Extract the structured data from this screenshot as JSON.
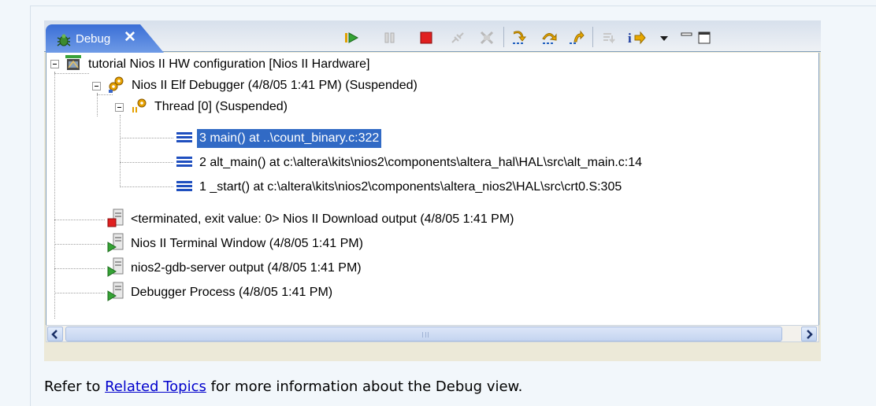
{
  "view": {
    "tab_label": "Debug",
    "tab_close": "✕",
    "toolbar": [
      {
        "name": "resume-icon"
      },
      {
        "name": "suspend-icon"
      },
      {
        "name": "terminate-icon"
      },
      {
        "name": "disconnect-icon"
      },
      {
        "name": "remove-terminated-icon"
      },
      {
        "name": "step-into-icon"
      },
      {
        "name": "step-over-icon"
      },
      {
        "name": "step-return-icon"
      },
      {
        "name": "drop-to-frame-icon"
      },
      {
        "name": "instruction-step-icon"
      },
      {
        "name": "view-menu-icon"
      },
      {
        "name": "minimize-icon"
      },
      {
        "name": "maximize-icon"
      }
    ]
  },
  "tree": {
    "launch": "tutorial Nios II HW configuration [Nios II Hardware]",
    "debugger": "Nios II Elf Debugger (4/8/05 1:41 PM) (Suspended)",
    "thread": "Thread [0] (Suspended)",
    "frames": [
      "3 main() at ..\\count_binary.c:322",
      "2 alt_main() at c:\\altera\\kits\\nios2\\components\\altera_hal\\HAL\\src\\alt_main.c:14",
      "1 _start() at c:\\altera\\kits\\nios2\\components\\altera_nios2\\HAL\\src\\crt0.S:305"
    ],
    "processes": [
      "<terminated, exit value: 0> Nios II Download output (4/8/05 1:41 PM)",
      "Nios II Terminal Window (4/8/05 1:41 PM)",
      "nios2-gdb-server output (4/8/05 1:41 PM)",
      "Debugger Process (4/8/05 1:41 PM)"
    ]
  },
  "scrollbar": {
    "grip": "III"
  },
  "footer": {
    "before": "Refer to ",
    "link": "Related Topics",
    "after": " for more information about the Debug view."
  },
  "colors": {
    "selection": "#316ac5",
    "tab": "#3a6ed6",
    "link": "#0000cc"
  }
}
